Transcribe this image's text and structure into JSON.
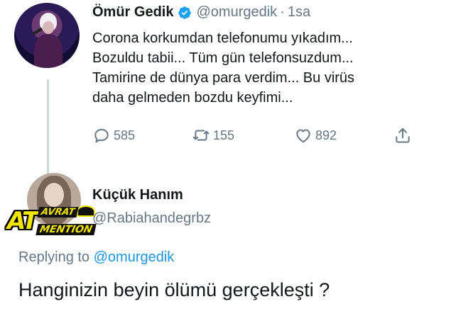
{
  "colors": {
    "text": "#14171a",
    "secondary": "#657786",
    "link": "#1b95e0",
    "verified": "#1da1f2",
    "thread_line": "#ccd6dd"
  },
  "tweet": {
    "author_name": "Ömür Gedik",
    "verified_icon": "verified-badge-icon",
    "handle": "@omurgedik",
    "separator": "·",
    "time": "1sa",
    "text_lines": [
      "Corona korkumdan telefonumu yıkadım...",
      "Bozuldu tabii... Tüm gün telefonsuzdum...",
      "Tamirine de dünya para verdim... Bu virüs",
      "daha gelmeden bozdu keyfimi..."
    ],
    "actions": {
      "reply": {
        "icon": "reply-icon",
        "count": "585"
      },
      "retweet": {
        "icon": "retweet-icon",
        "count": "155"
      },
      "like": {
        "icon": "heart-icon",
        "count": "892"
      },
      "share": {
        "icon": "share-icon"
      }
    }
  },
  "reply": {
    "author_name": "Küçük Hanım",
    "handle": "@Rabiahandegrbz",
    "replying_prefix": "Replying to",
    "replying_to": "@omurgedik",
    "text": "Hanginizin beyin ölümü gerçekleşti ?"
  },
  "watermark": {
    "big": "AT",
    "top": "AVRAT",
    "bottom": "MENTION"
  }
}
